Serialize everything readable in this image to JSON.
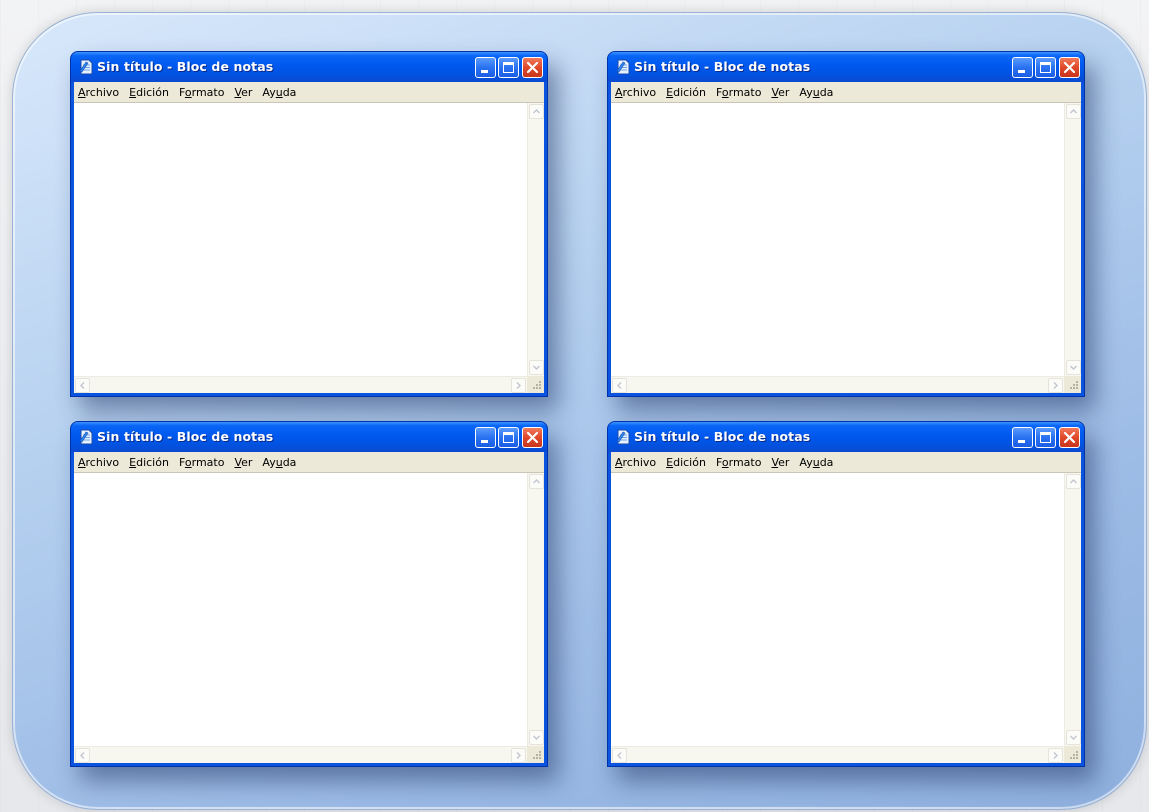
{
  "windows": [
    {
      "title": "Sin título - Bloc de notas",
      "menu": [
        "Archivo",
        "Edición",
        "Formato",
        "Ver",
        "Ayuda"
      ],
      "mnemonic_index": [
        0,
        0,
        1,
        0,
        2
      ],
      "text": ""
    },
    {
      "title": "Sin título - Bloc de notas",
      "menu": [
        "Archivo",
        "Edición",
        "Formato",
        "Ver",
        "Ayuda"
      ],
      "mnemonic_index": [
        0,
        0,
        1,
        0,
        2
      ],
      "text": ""
    },
    {
      "title": "Sin título - Bloc de notas",
      "menu": [
        "Archivo",
        "Edición",
        "Formato",
        "Ver",
        "Ayuda"
      ],
      "mnemonic_index": [
        0,
        0,
        1,
        0,
        2
      ],
      "text": ""
    },
    {
      "title": "Sin título - Bloc de notas",
      "menu": [
        "Archivo",
        "Edición",
        "Formato",
        "Ver",
        "Ayuda"
      ],
      "mnemonic_index": [
        0,
        0,
        1,
        0,
        2
      ],
      "text": ""
    }
  ],
  "icons": {
    "app": "notepad-icon",
    "minimize": "minimize-icon",
    "maximize": "maximize-icon",
    "close": "close-icon"
  },
  "colors": {
    "titlebar": "#0054e3",
    "close_button": "#e0472a",
    "menubar": "#ece9d8",
    "frame": "#b8d2f0"
  }
}
